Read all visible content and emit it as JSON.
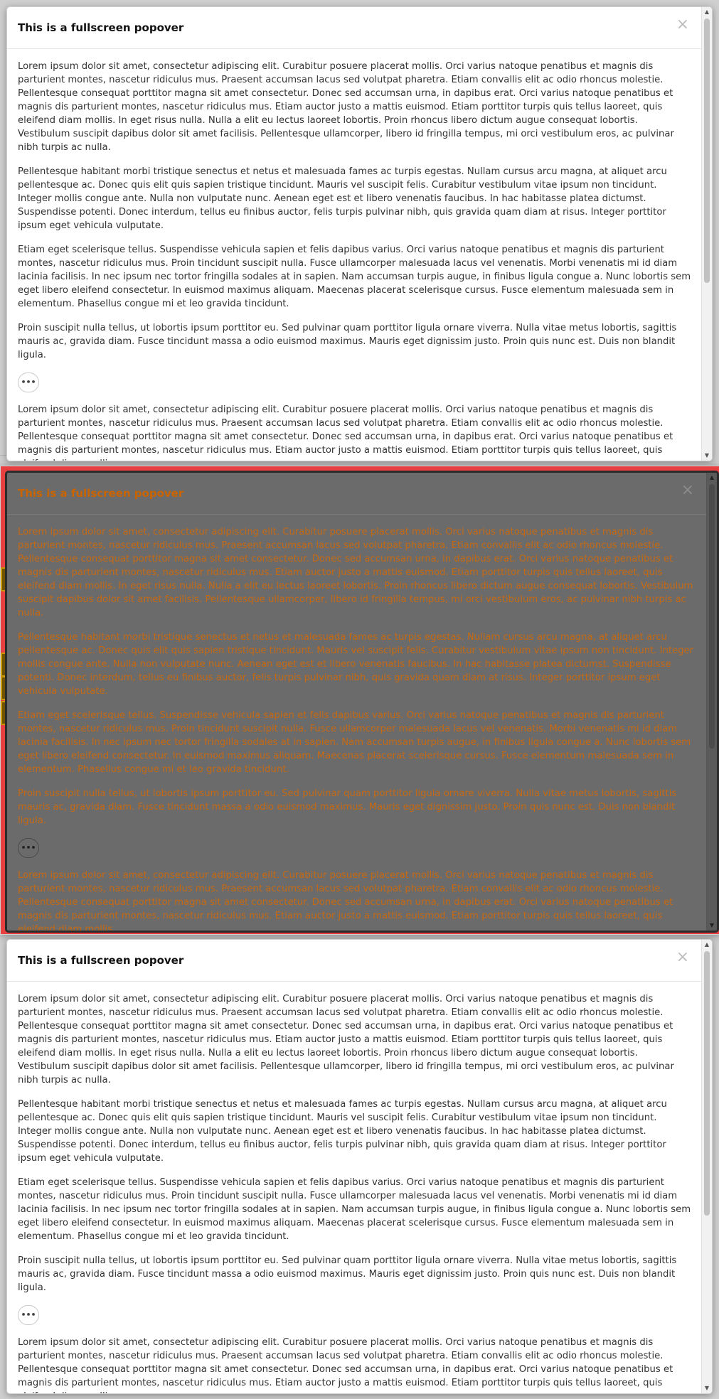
{
  "popover_title": "This is a fullscreen popover",
  "close_glyph": "×",
  "more_label": "•••",
  "scroll_up_glyph": "▲",
  "scroll_down_glyph": "▼",
  "paragraphs": [
    "Lorem ipsum dolor sit amet, consectetur adipiscing elit. Curabitur posuere placerat mollis. Orci varius natoque penatibus et magnis dis parturient montes, nascetur ridiculus mus. Praesent accumsan lacus sed volutpat pharetra. Etiam convallis elit ac odio rhoncus molestie. Pellentesque consequat porttitor magna sit amet consectetur. Donec sed accumsan urna, in dapibus erat. Orci varius natoque penatibus et magnis dis parturient montes, nascetur ridiculus mus. Etiam auctor justo a mattis euismod. Etiam porttitor turpis quis tellus laoreet, quis eleifend diam mollis. In eget risus nulla. Nulla a elit eu lectus laoreet lobortis. Proin rhoncus libero dictum augue consequat lobortis. Vestibulum suscipit dapibus dolor sit amet facilisis. Pellentesque ullamcorper, libero id fringilla tempus, mi orci vestibulum eros, ac pulvinar nibh turpis ac nulla.",
    "Pellentesque habitant morbi tristique senectus et netus et malesuada fames ac turpis egestas. Nullam cursus arcu magna, at aliquet arcu pellentesque ac. Donec quis elit quis sapien tristique tincidunt. Mauris vel suscipit felis. Curabitur vestibulum vitae ipsum non tincidunt. Integer mollis congue ante. Nulla non vulputate nunc. Aenean eget est et libero venenatis faucibus. In hac habitasse platea dictumst. Suspendisse potenti. Donec interdum, tellus eu finibus auctor, felis turpis pulvinar nibh, quis gravida quam diam at risus. Integer porttitor ipsum eget vehicula vulputate.",
    "Etiam eget scelerisque tellus. Suspendisse vehicula sapien et felis dapibus varius. Orci varius natoque penatibus et magnis dis parturient montes, nascetur ridiculus mus. Proin tincidunt suscipit nulla. Fusce ullamcorper malesuada lacus vel venenatis. Morbi venenatis mi id diam lacinia facilisis. In nec ipsum nec tortor fringilla sodales at in sapien. Nam accumsan turpis augue, in finibus ligula congue a. Nunc lobortis sem eget libero eleifend consectetur. In euismod maximus aliquam. Maecenas placerat scelerisque cursus. Fusce elementum malesuada sem in elementum. Phasellus congue mi et leo gravida tincidunt.",
    "Proin suscipit nulla tellus, ut lobortis ipsum porttitor eu. Sed pulvinar quam porttitor ligula ornare viverra. Nulla vitae metus lobortis, sagittis mauris ac, gravida diam. Fusce tincidunt massa a odio euismod maximus. Mauris eget dignissim justo. Proin quis nunc est. Duis non blandit ligula.",
    "Lorem ipsum dolor sit amet, consectetur adipiscing elit. Curabitur posuere placerat mollis. Orci varius natoque penatibus et magnis dis parturient montes, nascetur ridiculus mus. Praesent accumsan lacus sed volutpat pharetra. Etiam convallis elit ac odio rhoncus molestie. Pellentesque consequat porttitor magna sit amet consectetur. Donec sed accumsan urna, in dapibus erat. Orci varius natoque penatibus et magnis dis parturient montes, nascetur ridiculus mus. Etiam auctor justo a mattis euismod. Etiam porttitor turpis quis tellus laoreet, quis eleifend diam mollis."
  ],
  "colors": {
    "highlight_border": "#e84040",
    "dim_overlay": "#6b6b6b",
    "dim_text": "#c56a14"
  }
}
